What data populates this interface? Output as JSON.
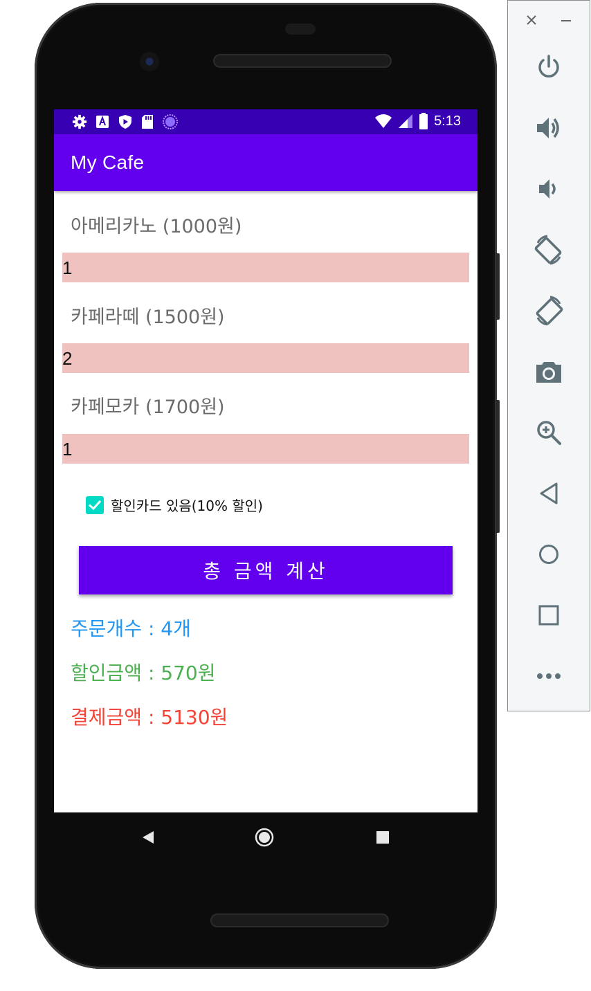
{
  "statusbar": {
    "time": "5:13"
  },
  "appbar": {
    "title": "My Cafe"
  },
  "menu": {
    "items": [
      {
        "label": "아메리카노 (1000원)",
        "quantity": "1"
      },
      {
        "label": "카페라떼 (1500원)",
        "quantity": "2"
      },
      {
        "label": "카페모카 (1700원)",
        "quantity": "1"
      }
    ]
  },
  "discount": {
    "label": "할인카드 있음(10% 할인)",
    "checked": true
  },
  "calculate_button": {
    "label": "총 금액 계산"
  },
  "results": {
    "order_count": "주문개수 : 4개",
    "discount_amount": "할인금액 : 570원",
    "payment_amount": "결제금액 : 5130원"
  },
  "colors": {
    "statusbar": "#3700b3",
    "primary": "#6200ee",
    "accent": "#03dac5",
    "field_bg": "#efc1bf",
    "order_count": "#2196f3",
    "discount_amount": "#4caf50",
    "payment_amount": "#f44336"
  },
  "emulator_toolbar": {
    "window_buttons": [
      "close-icon",
      "minimize-icon"
    ],
    "tools": [
      "power-icon",
      "volume-up-icon",
      "volume-down-icon",
      "rotate-left-icon",
      "rotate-right-icon",
      "camera-icon",
      "zoom-icon",
      "back-icon",
      "home-icon",
      "overview-icon",
      "more-icon"
    ]
  }
}
